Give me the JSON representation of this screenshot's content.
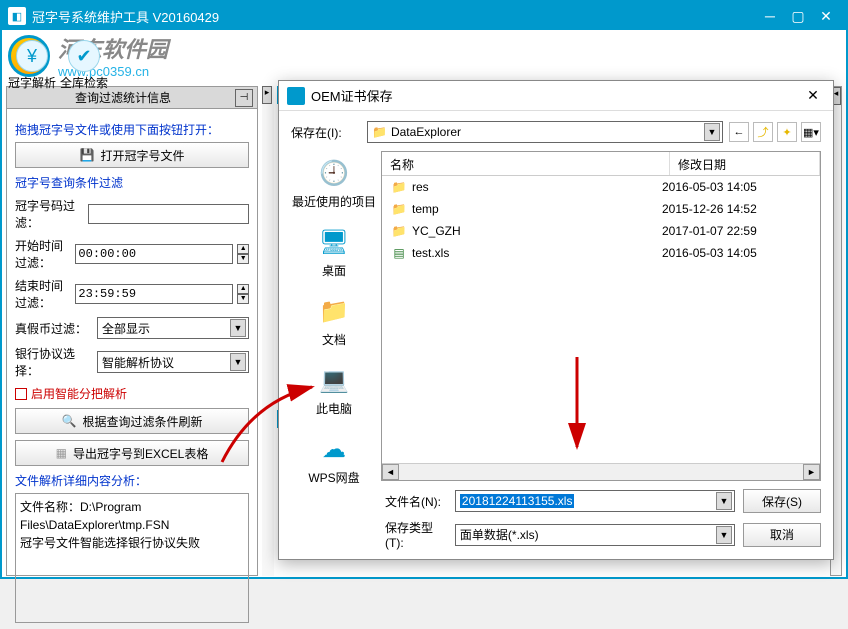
{
  "titlebar": {
    "title": "冠字号系统维护工具 V20160429"
  },
  "watermark": {
    "cn": "河东软件园",
    "url": "www.pc0359.cn"
  },
  "toolbar": {
    "parse": "冠字解析",
    "search": "全库检索"
  },
  "panel": {
    "title": "查询过滤统计信息",
    "drag_hint": "拖拽冠字号文件或使用下面按钮打开：",
    "open_btn": "打开冠字号文件",
    "filter_title": "冠字号查询条件过滤",
    "code_filter": "冠字号码过滤：",
    "start_time": "开始时间过滤：",
    "start_time_val": "00:00:00",
    "end_time": "结束时间过滤：",
    "end_time_val": "23:59:59",
    "real_fake": "真假币过滤：",
    "real_fake_val": "全部显示",
    "bank_proto": "银行协议选择：",
    "bank_proto_val": "智能解析协议",
    "enable_smart": "启用智能分把解析",
    "refresh_btn": "根据查询过滤条件刷新",
    "export_btn": "导出冠字号到EXCEL表格",
    "detail_title": "文件解析详细内容分析：",
    "detail_line1": "文件名称：D:\\Program Files\\DataExplorer\\tmp.FSN",
    "detail_line2": "",
    "detail_line3": "冠字号文件智能选择银行协议失败"
  },
  "dialog": {
    "title": "OEM证书保存",
    "save_in": "保存在(I):",
    "save_in_val": "DataExplorer",
    "col_name": "名称",
    "col_date": "修改日期",
    "files": [
      {
        "icon": "folder",
        "name": "res",
        "date": "2016-05-03 14:05"
      },
      {
        "icon": "folder",
        "name": "temp",
        "date": "2015-12-26 14:52"
      },
      {
        "icon": "folder",
        "name": "YC_GZH",
        "date": "2017-01-07 22:59"
      },
      {
        "icon": "xls",
        "name": "test.xls",
        "date": "2016-05-03 14:05"
      }
    ],
    "places": {
      "recent": "最近使用的项目",
      "desktop": "桌面",
      "documents": "文档",
      "computer": "此电脑",
      "network": "WPS网盘"
    },
    "filename_label": "文件名(N):",
    "filename_val": "20181224113155.xls",
    "filetype_label": "保存类型(T):",
    "filetype_val": "面单数据(*.xls)",
    "save_btn": "保存(S)",
    "cancel_btn": "取消"
  }
}
